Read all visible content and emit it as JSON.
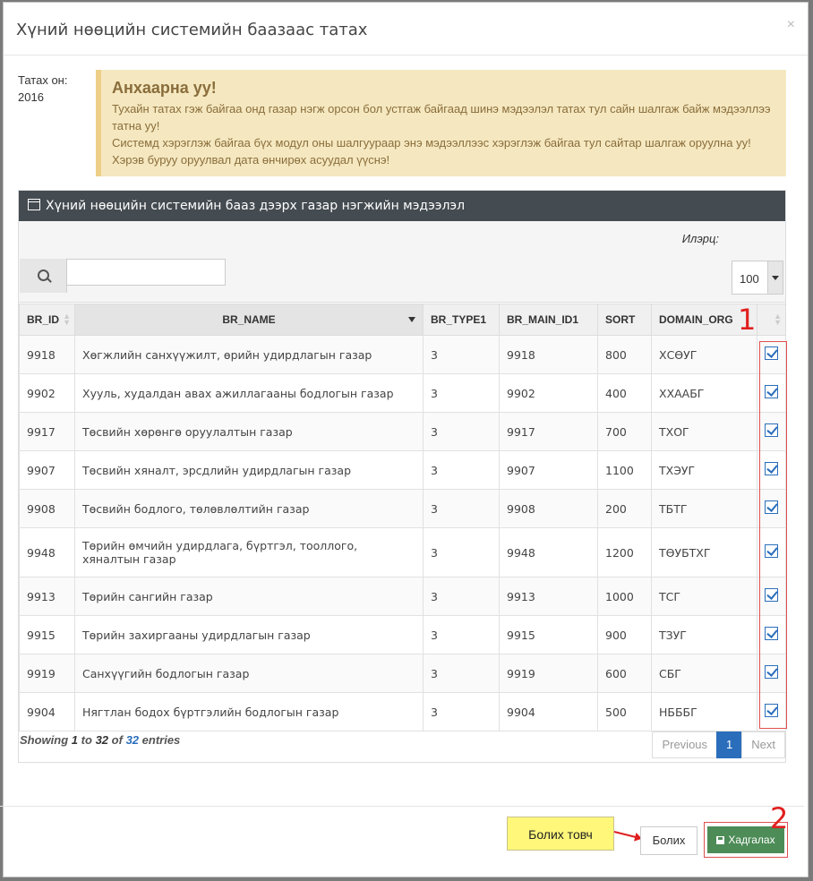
{
  "modal": {
    "title": "Хүний нөөцийн системийн баазаас татах",
    "close": "×"
  },
  "year": {
    "label": "Татах он:",
    "value": "2016"
  },
  "alert": {
    "title": "Анхаарна уу!",
    "line1": "Тухайн татах гэж байгаа онд газар нэгж орсон бол устгаж байгаад шинэ мэдээлэл татах тул сайн шалгаж байж мэдээллээ татна уу!",
    "line2": "Системд хэрэглэж байгаа бүх модул оны шалгуураар энэ мэдээллээс хэрэглэж байгаа тул сайтар шалгаж оруулна уу! Хэрэв буруу оруулвал дата өнчирөх асуудал үүснэ!"
  },
  "panel": {
    "title": "Хүний нөөцийн системийн бааз дээрх газар нэгжийн мэдээлэл",
    "found_label": "Илэрц:",
    "search_value": "",
    "page_size": "100"
  },
  "table": {
    "headers": [
      "BR_ID",
      "BR_NAME",
      "BR_TYPE1",
      "BR_MAIN_ID1",
      "SORT",
      "DOMAIN_ORG"
    ],
    "rows": [
      {
        "id": "9918",
        "name": "Хөгжлийн санхүүжилт, өрийн удирдлагын газар",
        "type": "3",
        "main": "9918",
        "sort": "800",
        "org": "ХСӨУГ",
        "checked": true
      },
      {
        "id": "9902",
        "name": "Хууль, худалдан авах ажиллагааны бодлогын газар",
        "type": "3",
        "main": "9902",
        "sort": "400",
        "org": "ХХААБГ",
        "checked": true
      },
      {
        "id": "9917",
        "name": "Төсвийн хөрөнгө оруулалтын газар",
        "type": "3",
        "main": "9917",
        "sort": "700",
        "org": "ТХОГ",
        "checked": true
      },
      {
        "id": "9907",
        "name": "Төсвийн хяналт, эрсдлийн удирдлагын газар",
        "type": "3",
        "main": "9907",
        "sort": "1100",
        "org": "ТХЭУГ",
        "checked": true
      },
      {
        "id": "9908",
        "name": "Төсвийн бодлого, төлөвлөлтийн газар",
        "type": "3",
        "main": "9908",
        "sort": "200",
        "org": "ТБТГ",
        "checked": true
      },
      {
        "id": "9948",
        "name": "Төрийн өмчийн удирдлага, бүртгэл, тооллого, хяналтын газар",
        "type": "3",
        "main": "9948",
        "sort": "1200",
        "org": "ТӨУБТХГ",
        "checked": true
      },
      {
        "id": "9913",
        "name": "Төрийн сангийн газар",
        "type": "3",
        "main": "9913",
        "sort": "1000",
        "org": "ТСГ",
        "checked": true
      },
      {
        "id": "9915",
        "name": "Төрийн захиргааны удирдлагын газар",
        "type": "3",
        "main": "9915",
        "sort": "900",
        "org": "ТЗУГ",
        "checked": true
      },
      {
        "id": "9919",
        "name": "Санхүүгийн бодлогын газар",
        "type": "3",
        "main": "9919",
        "sort": "600",
        "org": "СБГ",
        "checked": true
      },
      {
        "id": "9904",
        "name": "Нягтлан бодох бүртгэлийн бодлогын газар",
        "type": "3",
        "main": "9904",
        "sort": "500",
        "org": "НБББГ",
        "checked": true
      }
    ]
  },
  "info": {
    "showing": "Showing",
    "from": "1",
    "to_word": "to",
    "to": "32",
    "of_word": "of",
    "total": "32",
    "entries": "entries"
  },
  "pager": {
    "prev": "Previous",
    "page": "1",
    "next": "Next"
  },
  "annotations": {
    "marker1": "1",
    "marker2": "2",
    "note": "Болих товч"
  },
  "footer": {
    "cancel": "Болих",
    "save": "Хадгалах"
  },
  "colors": {
    "save_button": "#4d8c57",
    "alert_bg": "#f5e8c0",
    "panel_head": "#444b51",
    "accent": "#2a6ebb",
    "annotation_red": "#e02020",
    "note_bg": "#fff77a"
  }
}
